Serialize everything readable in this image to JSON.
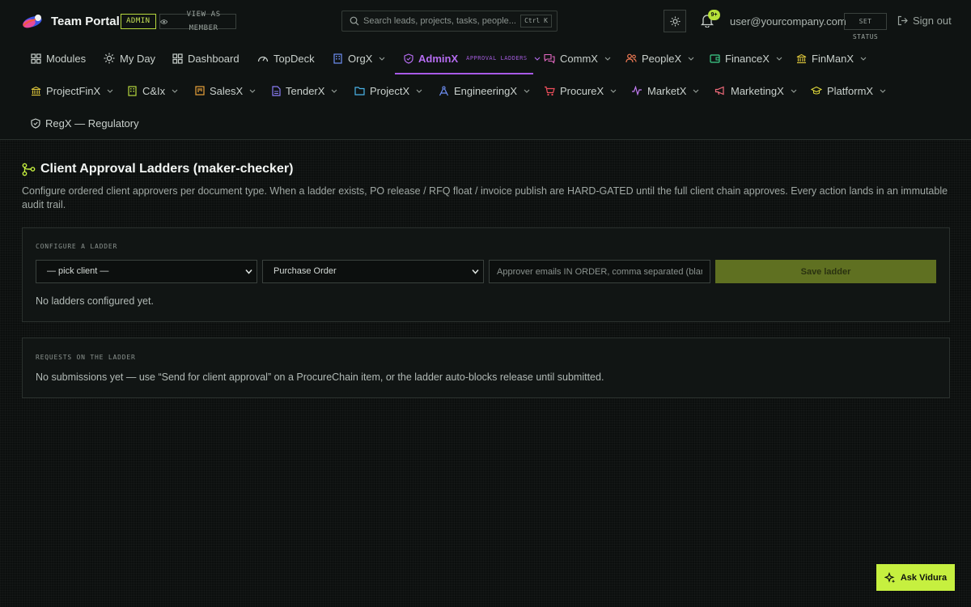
{
  "app": {
    "brand": "Team Portal",
    "role_badge": "ADMIN",
    "view_as_label": "VIEW AS MEMBER",
    "search_placeholder": "Search leads, projects, tasks, people...",
    "search_shortcut": "Ctrl K",
    "notification_count": "9+",
    "user_email": "user@yourcompany.com",
    "set_status_label": "SET STATUS",
    "signout_label": "Sign out"
  },
  "nav": {
    "row1": [
      {
        "label": "Modules",
        "icon": "grid-icon",
        "dropdown": false
      },
      {
        "label": "My Day",
        "icon": "sun-icon",
        "dropdown": false
      },
      {
        "label": "Dashboard",
        "icon": "grid-icon",
        "dropdown": false
      },
      {
        "label": "TopDeck",
        "icon": "gauge-icon",
        "dropdown": false
      },
      {
        "label": "OrgX",
        "icon": "building-icon",
        "dropdown": true
      },
      {
        "label": "AdminX",
        "sub": "APPROVAL LADDERS",
        "icon": "shield-icon",
        "dropdown": true,
        "active": true
      },
      {
        "label": "CommX",
        "icon": "chat-icon",
        "dropdown": true
      },
      {
        "label": "PeopleX",
        "icon": "people-icon",
        "dropdown": true
      },
      {
        "label": "FinanceX",
        "icon": "wallet-icon",
        "dropdown": true
      },
      {
        "label": "FinManX",
        "icon": "bank-icon",
        "dropdown": true
      }
    ],
    "row2": [
      {
        "label": "ProjectFinX",
        "icon": "bank-icon",
        "dropdown": true
      },
      {
        "label": "C&Ix",
        "icon": "building-icon",
        "dropdown": true
      },
      {
        "label": "SalesX",
        "icon": "kanban-icon",
        "dropdown": true
      },
      {
        "label": "TenderX",
        "icon": "document-icon",
        "dropdown": true
      },
      {
        "label": "ProjectX",
        "icon": "folder-icon",
        "dropdown": true
      },
      {
        "label": "EngineeringX",
        "icon": "compass-icon",
        "dropdown": true
      },
      {
        "label": "ProcureX",
        "icon": "cart-icon",
        "dropdown": true
      },
      {
        "label": "MarketX",
        "icon": "pulse-icon",
        "dropdown": true
      },
      {
        "label": "MarketingX",
        "icon": "megaphone-icon",
        "dropdown": true
      },
      {
        "label": "PlatformX",
        "icon": "graduation-icon",
        "dropdown": true
      }
    ],
    "row3": [
      {
        "label": "RegX — Regulatory",
        "icon": "shield-icon",
        "dropdown": false
      }
    ]
  },
  "page": {
    "title": "Client Approval Ladders (maker-checker)",
    "description": "Configure ordered client approvers per document type. When a ladder exists, PO release / RFQ float / invoice publish are HARD-GATED until the full client chain approves. Every action lands in an immutable audit trail."
  },
  "configure": {
    "label": "CONFIGURE A LADDER",
    "client_select": "— pick client —",
    "doc_type_select": "Purchase Order",
    "approvers_placeholder": "Approver emails IN ORDER, comma separated (blank = re",
    "save_label": "Save ladder",
    "empty_text": "No ladders configured yet."
  },
  "requests": {
    "label": "REQUESTS ON THE LADDER",
    "empty_text": "No submissions yet — use “Send for client approval” on a ProcureChain item, or the ladder auto-blocks release until submitted."
  },
  "assistant": {
    "label": "Ask Vidura"
  },
  "colors": {
    "accent_lime": "#c6f03f",
    "active_purple": "#b56cf0",
    "background": "#0c0f0e"
  }
}
